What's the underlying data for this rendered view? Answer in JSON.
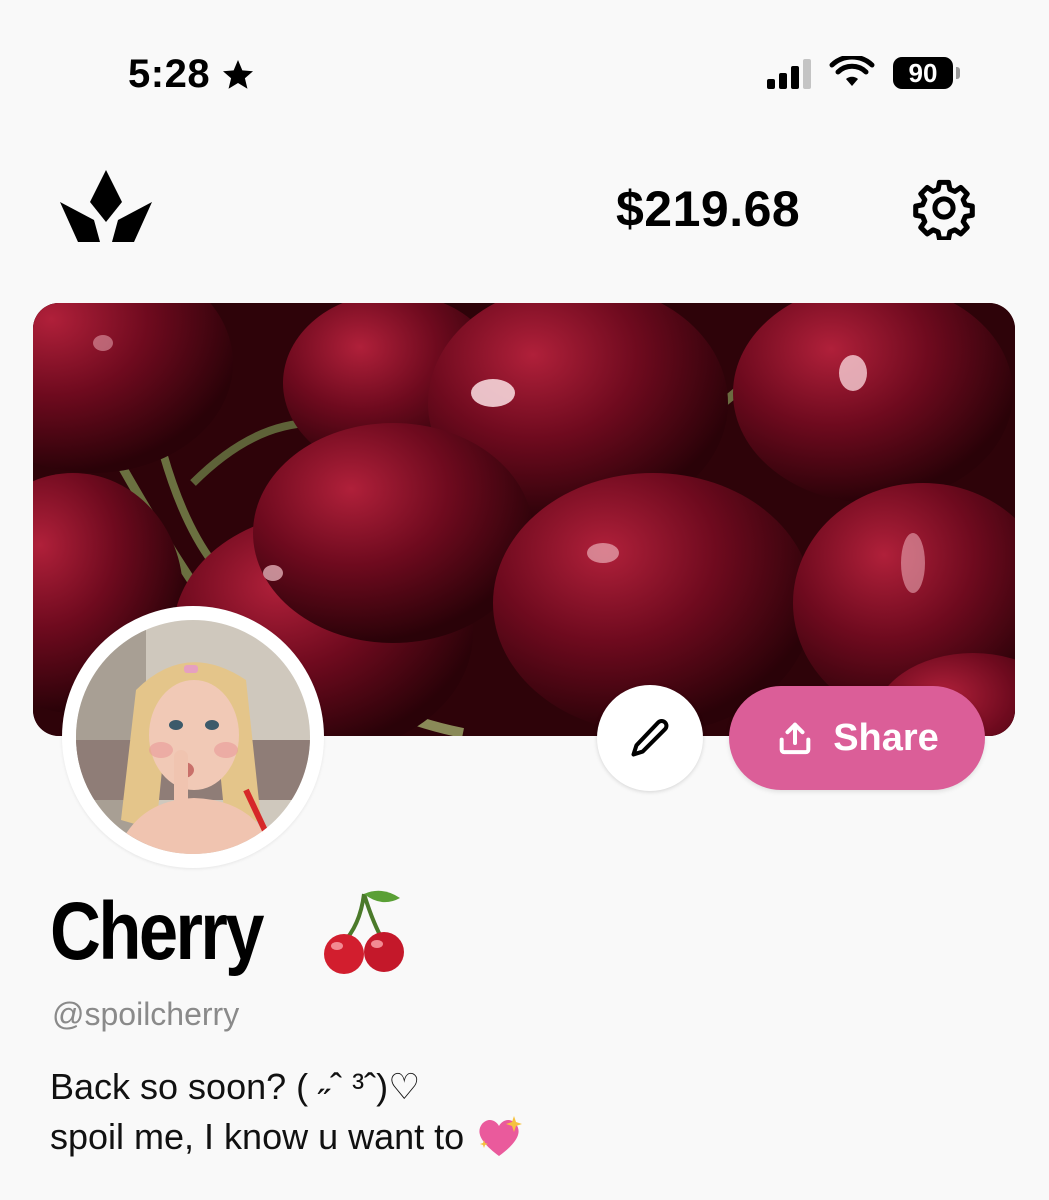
{
  "status_bar": {
    "time": "5:28",
    "battery": "90"
  },
  "header": {
    "balance": "$219.68"
  },
  "actions": {
    "share_label": "Share"
  },
  "profile": {
    "name": "Cherry",
    "handle": "@spoilcherry",
    "bio_line1": "Back so soon? ( ˶ˆ ³ˆ)♡",
    "bio_line2": "spoil me, I know u want to"
  },
  "colors": {
    "accent": "#db5e98",
    "background": "#f9f9f9"
  },
  "icons": [
    "crown-logo-icon",
    "settings-gear-icon",
    "pencil-icon",
    "share-upload-icon",
    "cherry-emoji-icon",
    "sparkling-heart-icon"
  ]
}
